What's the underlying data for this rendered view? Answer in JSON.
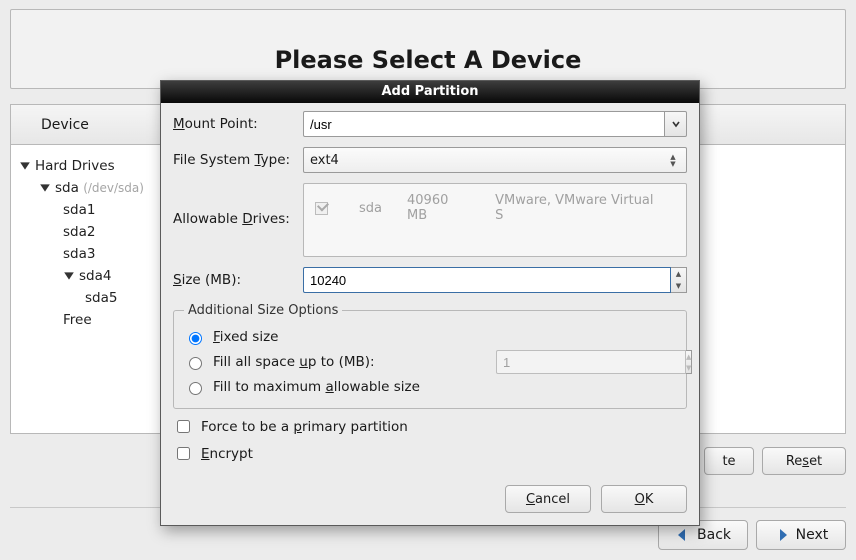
{
  "page": {
    "title": "Please Select A Device",
    "device_header": "Device"
  },
  "tree": {
    "root": "Hard Drives",
    "disk": "sda",
    "disk_hint": "(/dev/sda)",
    "parts": [
      "sda1",
      "sda2",
      "sda3",
      "sda4",
      "sda5",
      "Free"
    ]
  },
  "bottom_buttons": {
    "delete": "te",
    "reset_text": "Re",
    "reset_u": "s",
    "reset_after": "et"
  },
  "nav": {
    "back_u": "B",
    "back_after": "ack",
    "next_u": "N",
    "next_after": "ext"
  },
  "modal": {
    "title": "Add Partition",
    "mount_label_u": "M",
    "mount_label_after": "ount Point:",
    "mount_value": "/usr",
    "fs_label_before": "File System ",
    "fs_label_u": "T",
    "fs_label_after": "ype:",
    "fs_value": "ext4",
    "drives_label_before": "Allowable ",
    "drives_label_u": "D",
    "drives_label_after": "rives:",
    "drive_name": "sda",
    "drive_size": "40960 MB",
    "drive_vendor": "VMware, VMware Virtual S",
    "size_label_u": "S",
    "size_label_after": "ize (MB):",
    "size_value": "10240",
    "size_opts_legend": "Additional Size Options",
    "opt_fixed_u": "F",
    "opt_fixed_after": "ixed size",
    "opt_fill_before": "Fill all space ",
    "opt_fill_u": "u",
    "opt_fill_after": "p to (MB):",
    "opt_fill_value": "1",
    "opt_max_before": "Fill to maximum ",
    "opt_max_u": "a",
    "opt_max_after": "llowable size",
    "force_before": "Force to be a ",
    "force_u": "p",
    "force_after": "rimary partition",
    "encrypt_u": "E",
    "encrypt_after": "ncrypt",
    "cancel_u": "C",
    "cancel_after": "ancel",
    "ok_u": "O",
    "ok_after": "K"
  }
}
